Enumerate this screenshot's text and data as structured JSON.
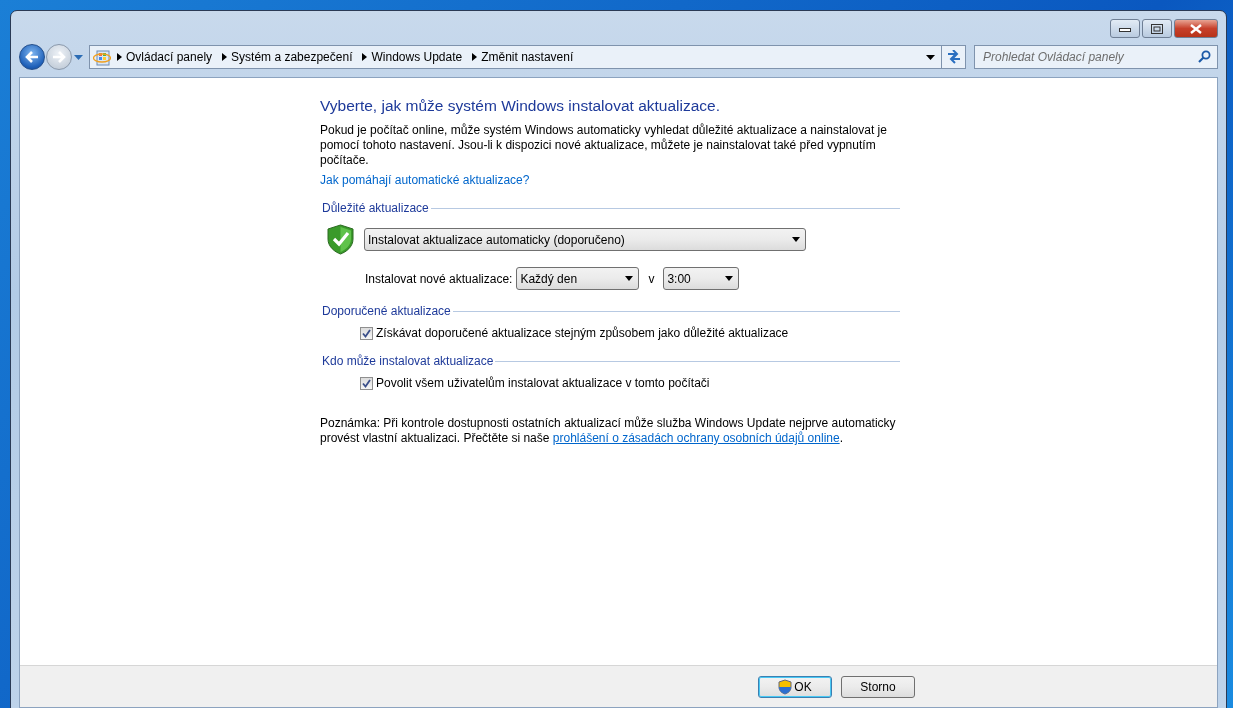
{
  "nav": {
    "breadcrumb": [
      "Ovládací panely",
      "Systém a zabezpečení",
      "Windows Update",
      "Změnit nastavení"
    ],
    "search": {
      "placeholder": "Prohledat Ovládací panely"
    }
  },
  "heading": "Vyberte, jak může systém Windows instalovat aktualizace.",
  "intro": "Pokud je počítač online, může systém Windows automaticky vyhledat důležité aktualizace a nainstalovat je pomocí tohoto nastavení. Jsou-li k dispozici nové aktualizace, můžete je nainstalovat také před vypnutím počítače.",
  "help_link": "Jak pomáhají automatické aktualizace?",
  "sections": [
    {
      "title": "Důležité aktualizace",
      "items": [
        {
          "kind": "dropdown",
          "value": "Instalovat aktualizace automaticky (doporučeno)"
        },
        {
          "kind": "schedule",
          "label": "Instalovat nové aktualizace:",
          "day": "Každý den",
          "separator": "v",
          "time": "3:00"
        }
      ]
    },
    {
      "title": "Doporučené aktualizace",
      "items": [
        {
          "kind": "checkbox",
          "label": "Získávat doporučené aktualizace stejným způsobem jako důležité aktualizace",
          "checked": true
        }
      ]
    },
    {
      "title": "Kdo může instalovat aktualizace",
      "items": [
        {
          "kind": "checkbox",
          "label": "Povolit všem uživatelům instalovat aktualizace v tomto počítači",
          "checked": true
        }
      ]
    }
  ],
  "note": {
    "text": "Poznámka: Při kontrole dostupnosti ostatních aktualizací může služba Windows Update nejprve automaticky provést vlastní aktualizaci. Přečtěte si naše ",
    "link": "prohlášení o zásadách ochrany osobních údajů online",
    "end": "."
  },
  "buttons": [
    {
      "label": "OK",
      "kind": "primary"
    },
    {
      "label": "Storno",
      "kind": "normal"
    }
  ]
}
